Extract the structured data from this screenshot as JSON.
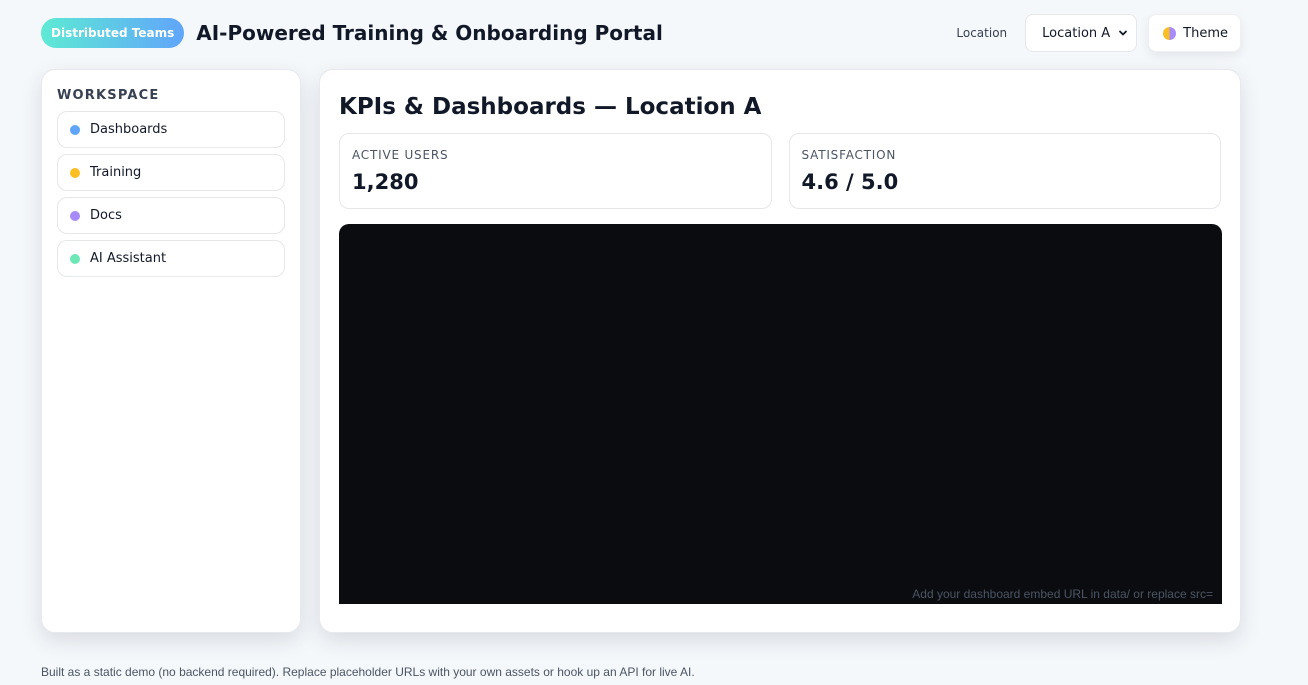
{
  "header": {
    "badge": "Distributed Teams",
    "title": "AI-Powered Training & Onboarding Portal",
    "location_label": "Location",
    "location_selected": "Location A",
    "theme_label": "Theme"
  },
  "sidebar": {
    "heading": "WORKSPACE",
    "items": [
      {
        "label": "Dashboards",
        "color": "#60a5fa"
      },
      {
        "label": "Training",
        "color": "#fbbf24"
      },
      {
        "label": "Docs",
        "color": "#a78bfa"
      },
      {
        "label": "AI Assistant",
        "color": "#6ee7b7"
      }
    ]
  },
  "main": {
    "title": "KPIs & Dashboards — Location A",
    "kpis": [
      {
        "label": "ACTIVE USERS",
        "value": "1,280"
      },
      {
        "label": "SATISFACTION",
        "value": "4.6 / 5.0"
      }
    ],
    "embed_hint": "Add your dashboard embed URL in data/ or replace src="
  },
  "footer": {
    "text": "Built as a static demo (no backend required). Replace placeholder URLs with your own assets or hook up an API for live AI."
  },
  "colors": {
    "background": "#f5f8fb",
    "embed_bg": "#0b0c10",
    "badge_gradient": [
      "#5eead4",
      "#60a5fa"
    ]
  }
}
